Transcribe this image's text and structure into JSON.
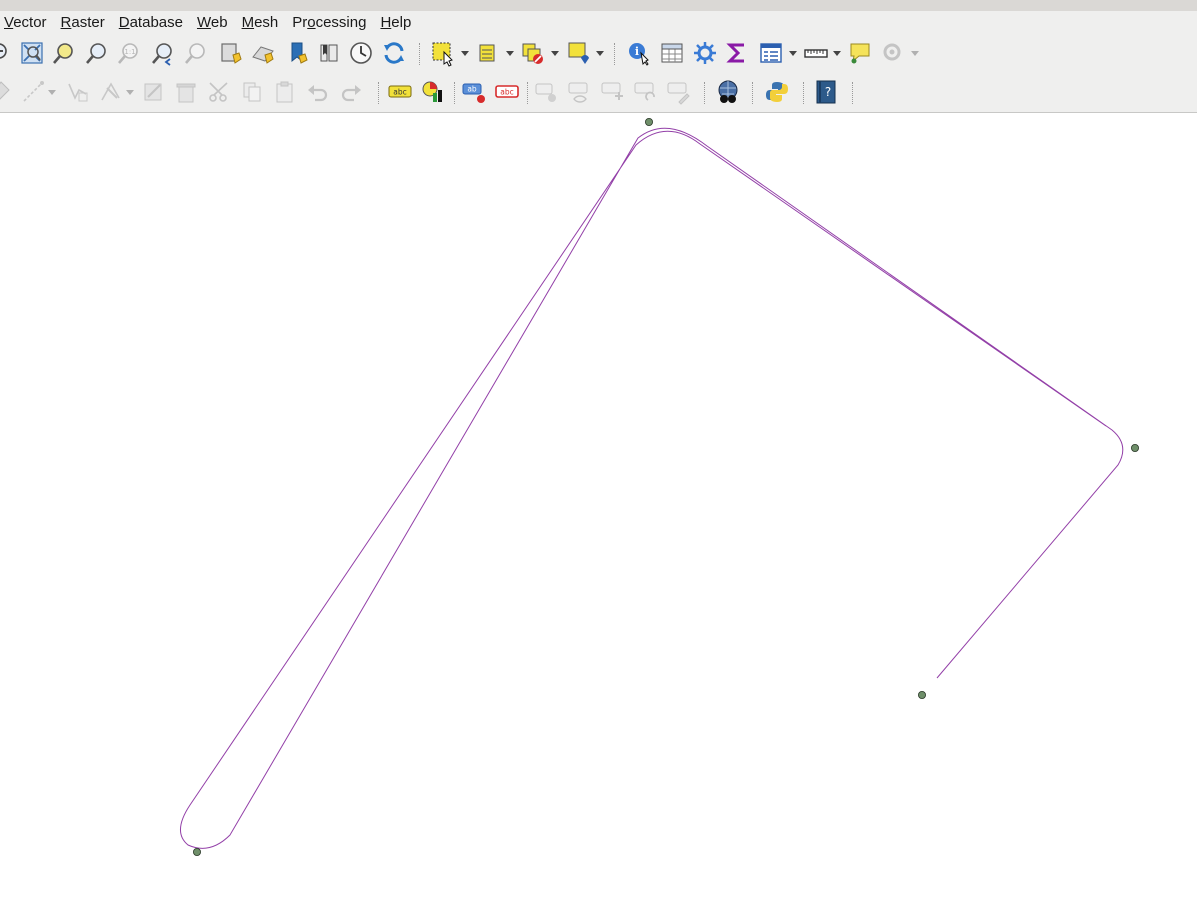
{
  "menubar": {
    "items": [
      {
        "label": "Vector",
        "accel_index": 0
      },
      {
        "label": "Raster",
        "accel_index": 0
      },
      {
        "label": "Database",
        "accel_index": 0
      },
      {
        "label": "Web",
        "accel_index": 0
      },
      {
        "label": "Mesh",
        "accel_index": 0
      },
      {
        "label": "Processing",
        "accel_index": 2
      },
      {
        "label": "Help",
        "accel_index": 0
      }
    ]
  },
  "toolbar": {
    "labels": {
      "label_tool_text": "abc",
      "pin_label_text": "ab",
      "hide_label_text": "abc"
    }
  },
  "colors": {
    "line": "#9340a8",
    "vertex_fill": "#6f8f6a",
    "vertex_stroke": "#2c3a2a",
    "yellow": "#f2e13a",
    "blue": "#3a7bd5",
    "teal": "#2b6e8e",
    "purple": "#8a1aa6"
  }
}
